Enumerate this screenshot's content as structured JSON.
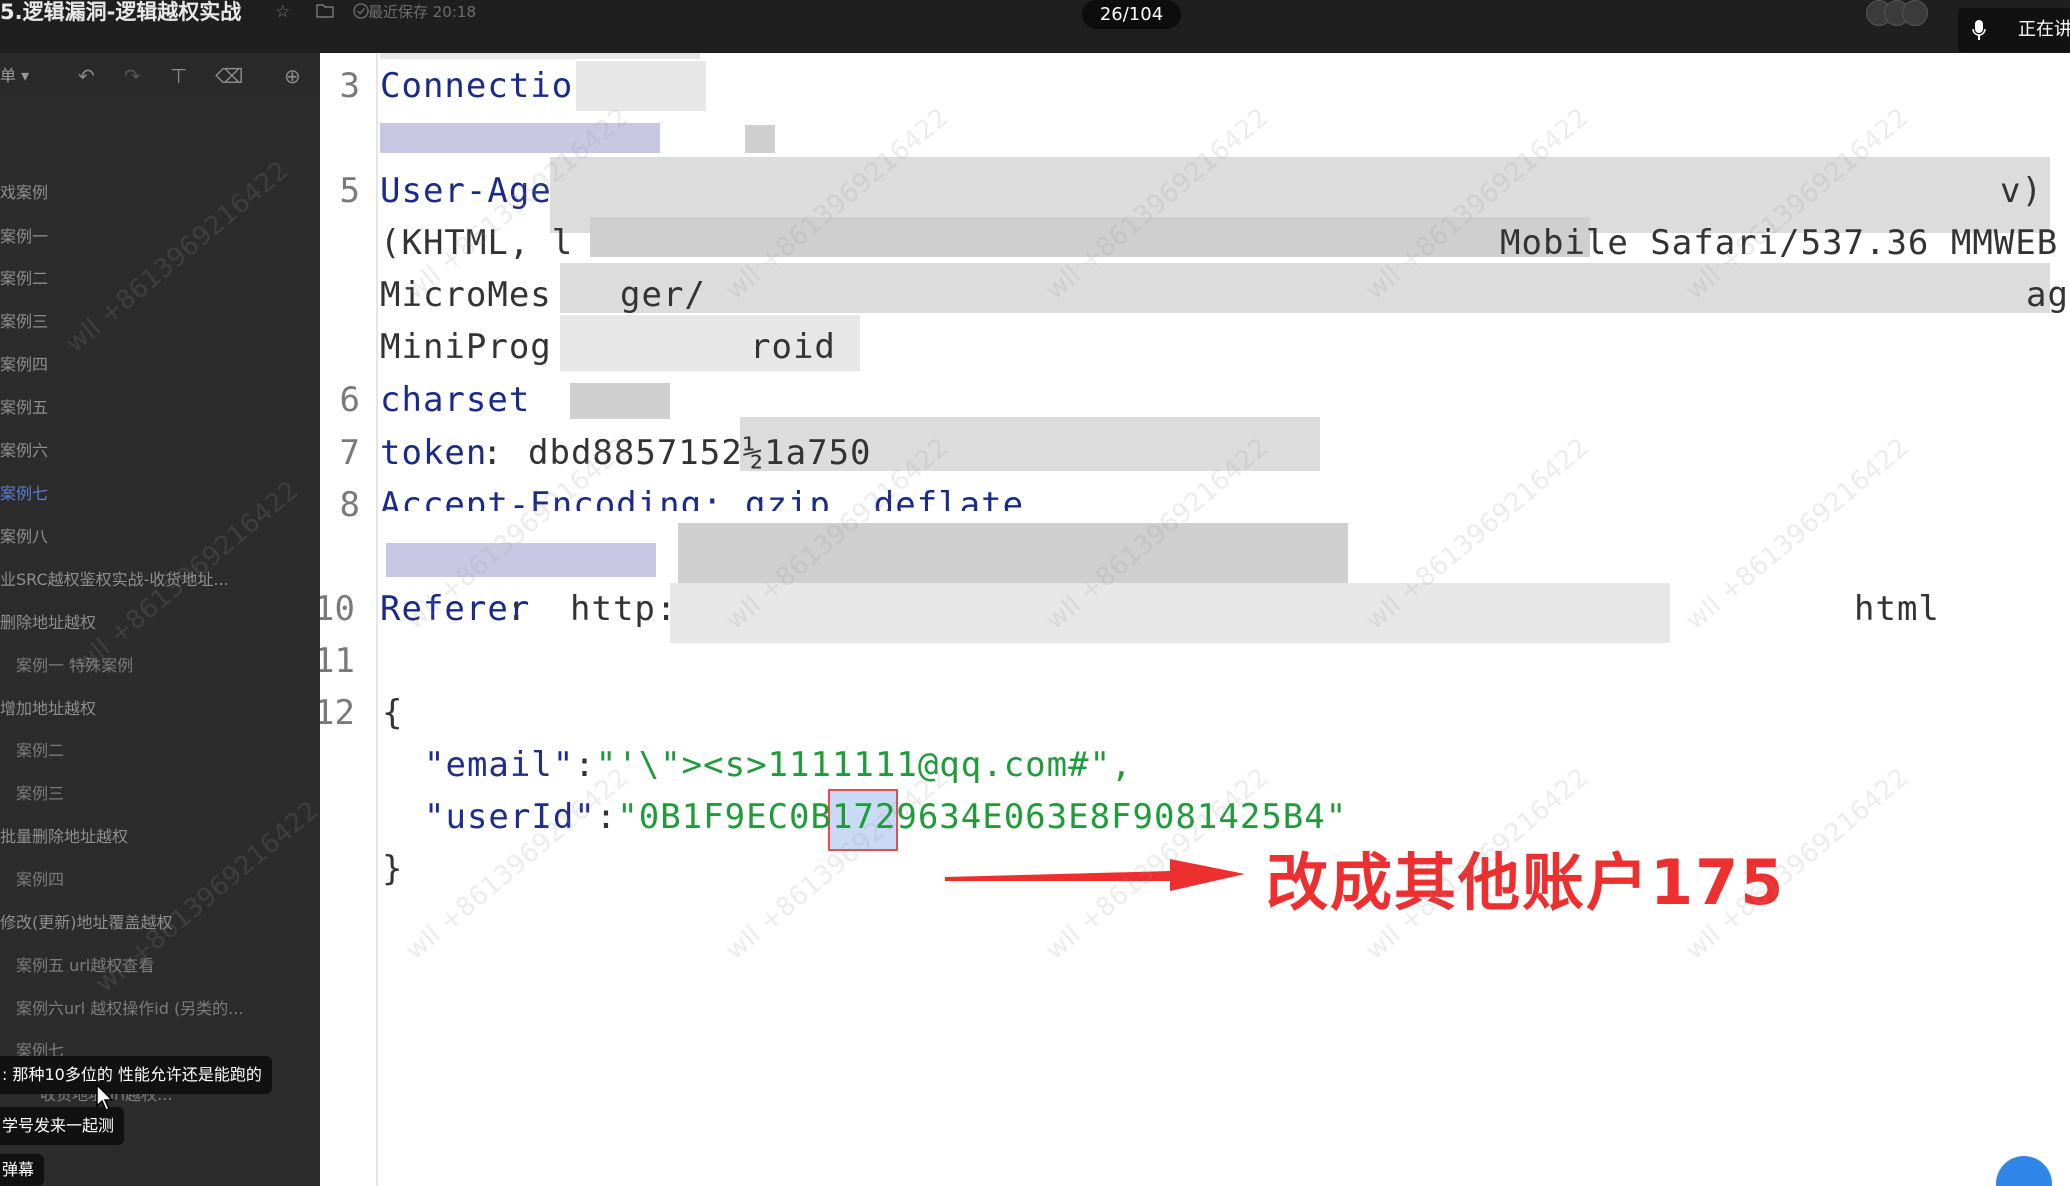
{
  "window": {
    "title": "5.逻辑漏洞-逻辑越权实战",
    "saved_text": "最近保存 20:18",
    "page_indicator": "26/104",
    "speaking_label": "正在讲"
  },
  "toolbar": {
    "menu_label": "单 ▾"
  },
  "sidebar": {
    "items": [
      {
        "label": "戏案例",
        "state": "normal"
      },
      {
        "label": "案例一",
        "state": "normal"
      },
      {
        "label": "案例二",
        "state": "normal"
      },
      {
        "label": "案例三",
        "state": "normal"
      },
      {
        "label": "案例四",
        "state": "normal"
      },
      {
        "label": "案例五",
        "state": "normal"
      },
      {
        "label": "案例六",
        "state": "normal"
      },
      {
        "label": "案例七",
        "state": "active"
      },
      {
        "label": "案例八",
        "state": "normal"
      },
      {
        "label": "业SRC越权鉴权实战-收货地址...",
        "state": "normal"
      },
      {
        "label": "删除地址越权",
        "state": "normal"
      },
      {
        "label": "案例一 特殊案例",
        "state": "sub"
      },
      {
        "label": "增加地址越权",
        "state": "normal"
      },
      {
        "label": "案例二",
        "state": "sub"
      },
      {
        "label": "案例三",
        "state": "sub"
      },
      {
        "label": "批量删除地址越权",
        "state": "normal"
      },
      {
        "label": "案例四",
        "state": "sub"
      },
      {
        "label": "修改(更新)地址覆盖越权",
        "state": "normal"
      },
      {
        "label": "案例五 url越权查看",
        "state": "sub"
      },
      {
        "label": "案例六url 越权操作id (另类的...",
        "state": "sub"
      },
      {
        "label": "案例七",
        "state": "sub"
      },
      {
        "label": "收货地址url越权...",
        "state": "sub"
      }
    ],
    "danmaku": [
      ": 那种10多位的  性能允许还是能跑的",
      "学号发来一起测",
      "弹幕"
    ]
  },
  "editor": {
    "line_numbers": [
      "3",
      "5",
      "6",
      "7",
      "8",
      "10",
      "11",
      "12"
    ],
    "lines": {
      "l3": "Connectio",
      "l5": "User-Age",
      "l5_tail": "v)",
      "l5b": "(KHTML, l",
      "l5b_tail": "Mobile Safari/537.36 MMWEB",
      "l5c": "MicroMes",
      "l5c_mid": "ger/",
      "l5c_tail": "ag",
      "l5d": "MiniProg",
      "l5d_tail": "roid",
      "l6": "charset",
      "l7_key": "token",
      "l7_val": "dbd8857152½1a750",
      "l8": "Accept-Encoding: gzip, deflate",
      "l10_key": "Referer",
      "l10_val": "http:",
      "l10_tail": "html",
      "open_brace": "{",
      "email_key": "\"email\"",
      "email_val": "\"'\\\"><s>1111111@qq.com#\",",
      "userid_key": "\"userId\"",
      "userid_val": "\"0B1F9EC0B1729634E063E8F9081425B4\"",
      "close_brace": "}"
    },
    "annotation": "改成其他账户175",
    "watermark": "wll +8613969216422",
    "colors": {
      "keyword": "#1a2a88",
      "string": "#1e9c3a",
      "annotation": "#ee2f2f"
    }
  }
}
